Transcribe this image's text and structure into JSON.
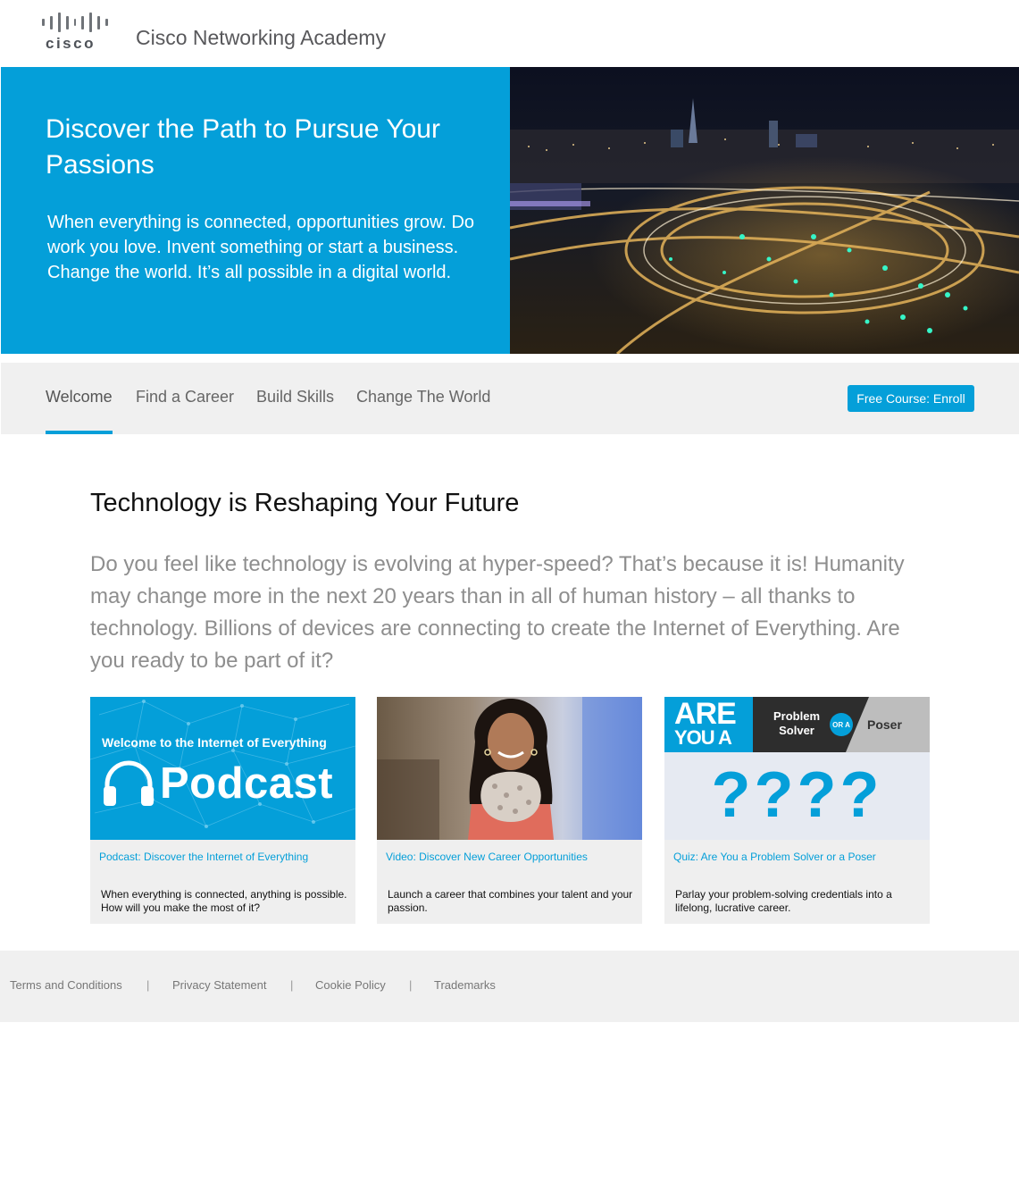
{
  "header": {
    "logo_text": "cisco",
    "title": "Cisco Networking Academy"
  },
  "hero": {
    "title": "Discover the Path to Pursue Your Passions",
    "text": "When everything is connected, opportunities grow. Do work you love. Invent something or start a business. Change the world. It’s all possible in a digital world.",
    "image_icon": "night-city-highway-photo"
  },
  "nav": {
    "tabs": [
      {
        "label": "Welcome",
        "active": true
      },
      {
        "label": "Find a Career",
        "active": false
      },
      {
        "label": "Build Skills",
        "active": false
      },
      {
        "label": "Change The World",
        "active": false
      }
    ],
    "enroll_label": "Free Course: Enroll"
  },
  "main": {
    "title": "Technology is Reshaping Your Future",
    "intro": "Do you feel like technology is evolving at hyper-speed? That’s because it is! Humanity may change more in the next 20 years than in all of human history – all thanks to technology. Billions of devices are connecting to create the Internet of Everything. Are you ready to be part of it?"
  },
  "cards": [
    {
      "link": "Podcast: Discover the Internet of Everything",
      "desc": "When everything is connected, anything is possible. How will you make the most of it?",
      "image": {
        "subtitle": "Welcome to the Internet of Everything",
        "title": "Podcast",
        "icon": "headphones-icon"
      }
    },
    {
      "link": "Video: Discover New Career Opportunities",
      "desc": "Launch a career that combines your talent and your passion.",
      "image": {
        "icon": "woman-portrait-photo"
      }
    },
    {
      "link": "Quiz: Are You a Problem Solver or a Poser",
      "desc": "Parlay your problem-solving credentials into a lifelong, lucrative career.",
      "image": {
        "are": "ARE",
        "you_a": "YOU A",
        "solver": "Problem Solver",
        "or_a": "OR A",
        "poser": "Poser",
        "marks": "????"
      }
    }
  ],
  "footer": {
    "links": [
      "Terms and Conditions",
      "Privacy Statement",
      "Cookie Policy",
      "Trademarks"
    ],
    "separator": "|"
  },
  "colors": {
    "accent": "#049fd9",
    "nav_bg": "#f0f0f0",
    "card_bg": "#efefef"
  }
}
